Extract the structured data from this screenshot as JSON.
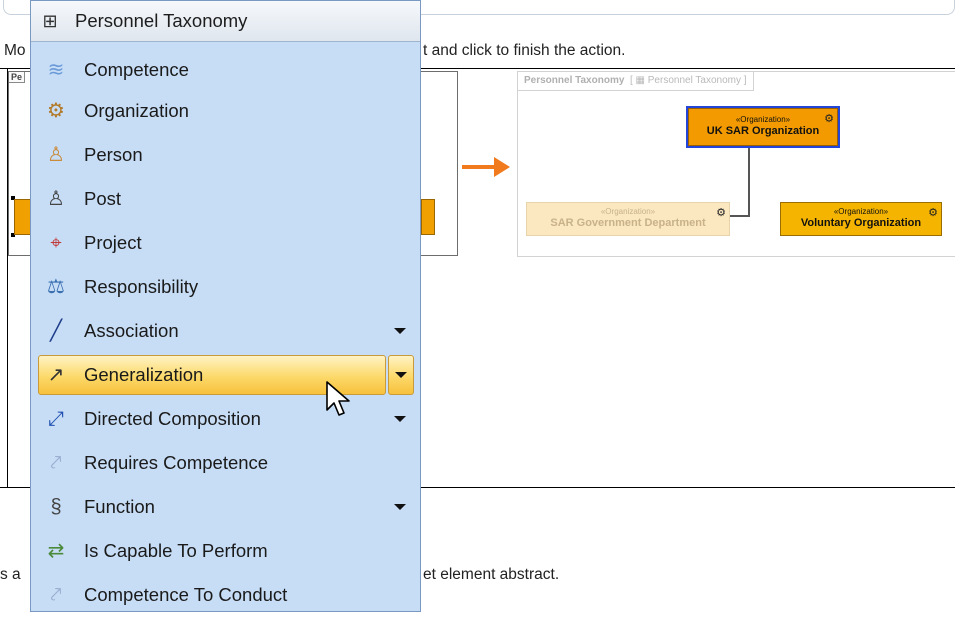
{
  "document": {
    "line1_left": "Mo",
    "line1_right": "t and click to finish the action.",
    "line2_left": "s a",
    "line2_right": "et element abstract."
  },
  "before_diagram": {
    "frame_title": "Pe"
  },
  "after_diagram": {
    "frame_name": "Personnel Taxonomy",
    "frame_tab_suffix": "Personnel Taxonomy",
    "boxes": [
      {
        "stereotype": "«Organization»",
        "name": "UK SAR Organization"
      },
      {
        "stereotype": "«Organization»",
        "name": "SAR Government Department"
      },
      {
        "stereotype": "«Organization»",
        "name": "Voluntary Organization"
      }
    ]
  },
  "palette": {
    "title": "Personnel Taxonomy",
    "title_icon": "diagram-icon",
    "items": [
      {
        "label": "Competence",
        "icon": "competence-icon",
        "dropdown": false
      },
      {
        "label": "Organization",
        "icon": "organization-icon",
        "dropdown": false
      },
      {
        "label": "Person",
        "icon": "person-icon",
        "dropdown": false
      },
      {
        "label": "Post",
        "icon": "post-icon",
        "dropdown": false
      },
      {
        "label": "Project",
        "icon": "project-icon",
        "dropdown": false
      },
      {
        "label": "Responsibility",
        "icon": "responsibility-icon",
        "dropdown": false
      },
      {
        "label": "Association",
        "icon": "association-icon",
        "dropdown": true
      },
      {
        "label": "Generalization",
        "icon": "generalization-icon",
        "dropdown": true,
        "selected": true
      },
      {
        "label": "Directed Composition",
        "icon": "directed-composition-icon",
        "dropdown": true
      },
      {
        "label": "Requires Competence",
        "icon": "requires-competence-icon",
        "dropdown": false
      },
      {
        "label": "Function",
        "icon": "function-icon",
        "dropdown": true
      },
      {
        "label": "Is Capable To Perform",
        "icon": "is-capable-to-perform-icon",
        "dropdown": false
      },
      {
        "label": "Competence To Conduct",
        "icon": "competence-to-conduct-icon",
        "dropdown": false
      }
    ]
  },
  "colors": {
    "menu_bg": "#c7ddf6",
    "highlight": "#fcd96a",
    "arrow": "#f07a1c",
    "selection": "#2446d8"
  }
}
